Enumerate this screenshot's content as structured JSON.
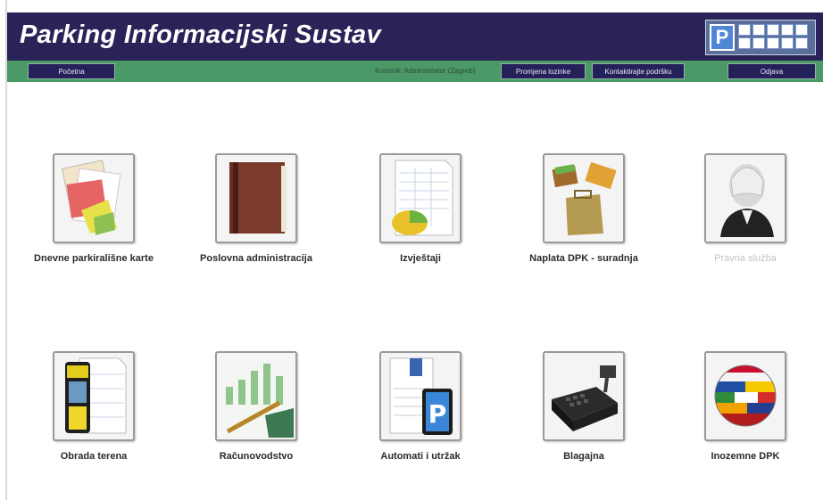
{
  "header": {
    "title": "Parking Informacijski Sustav",
    "logo_letter": "P"
  },
  "navbar": {
    "home_button": "Početna",
    "user_text": "Korisnik: Administrator (Zagreb)",
    "buttons": [
      "Promjena lozinke",
      "Kontaktirajte podršku"
    ],
    "logout_button": "Odjava"
  },
  "tiles": [
    {
      "label": "Dnevne parkirališne karte",
      "icon": "parking-tickets-icon",
      "enabled": true
    },
    {
      "label": "Poslovna administracija",
      "icon": "book-icon",
      "enabled": true
    },
    {
      "label": "Izvještaji",
      "icon": "report-chart-icon",
      "enabled": true
    },
    {
      "label": "Naplata DPK - suradnja",
      "icon": "wallet-bag-icon",
      "enabled": true
    },
    {
      "label": "Pravna služba",
      "icon": "legal-person-icon",
      "enabled": false
    },
    {
      "label": "Obrada terena",
      "icon": "handheld-terminal-icon",
      "enabled": true
    },
    {
      "label": "Računovodstvo",
      "icon": "accounting-chart-icon",
      "enabled": true
    },
    {
      "label": "Automati i utržak",
      "icon": "parking-meter-icon",
      "enabled": true
    },
    {
      "label": "Blagajna",
      "icon": "cash-register-icon",
      "enabled": true
    },
    {
      "label": "Inozemne DPK",
      "icon": "globe-flags-icon",
      "enabled": true
    }
  ],
  "colors": {
    "header_bg": "#2a2358",
    "navbar_bg": "#4c9968",
    "nav_button_bg": "#23205a"
  }
}
